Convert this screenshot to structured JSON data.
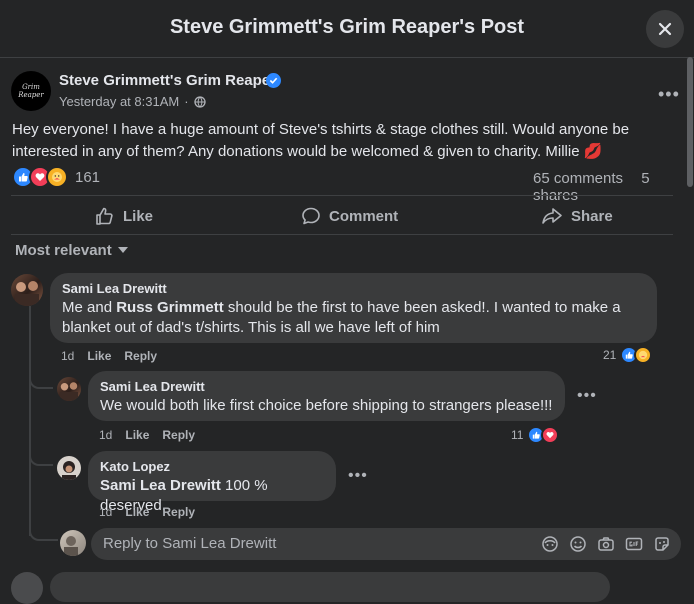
{
  "header": {
    "title": "Steve Grimmett's Grim Reaper's Post"
  },
  "post": {
    "author": "Steve Grimmett's Grim Reaper",
    "avatar_text": "Grim Reaper",
    "time": "Yesterday at 8:31AM",
    "text": "Hey everyone! I have a huge amount of Steve's tshirts & stage clothes still. Would anyone be interested in any of them? Any donations would be welcomed & given to charity. Millie 💋",
    "reaction_count": "161",
    "comments": "65 comments",
    "shares": "5 shares"
  },
  "actions": {
    "like": "Like",
    "comment": "Comment",
    "share": "Share"
  },
  "sort_label": "Most relevant",
  "comments": [
    {
      "name": "Sami Lea Drewitt",
      "text_pre": "Me and ",
      "mention": "Russ Grimmett",
      "text_post": " should be the first to have been asked!. I wanted to make a blanket out of dad's t/shirts. This is all we have left of him",
      "time": "1d",
      "like": "Like",
      "reply": "Reply",
      "reactions": "21"
    }
  ],
  "replies": [
    {
      "name": "Sami Lea Drewitt",
      "text": "We would both like first choice before shipping to strangers please!!!",
      "time": "1d",
      "like": "Like",
      "reply": "Reply",
      "reactions": "11"
    },
    {
      "name": "Kato Lopez",
      "mention": "Sami Lea Drewitt",
      "text": " 100 % deserved.",
      "time": "1d",
      "like": "Like",
      "reply": "Reply"
    }
  ],
  "reply_box": {
    "placeholder": "Reply to Sami Lea Drewitt"
  },
  "colors": {
    "background": "#242526",
    "bubble": "#3a3b3c",
    "accent": "#2d88ff",
    "love": "#f33e58"
  },
  "icons": [
    "close-icon",
    "verified-icon",
    "globe-icon",
    "more-icon",
    "like-icon",
    "comment-icon",
    "share-icon",
    "caret-down-icon",
    "emoji-icon",
    "camera-icon",
    "gif-icon",
    "sticker-icon",
    "avatar-icon"
  ]
}
